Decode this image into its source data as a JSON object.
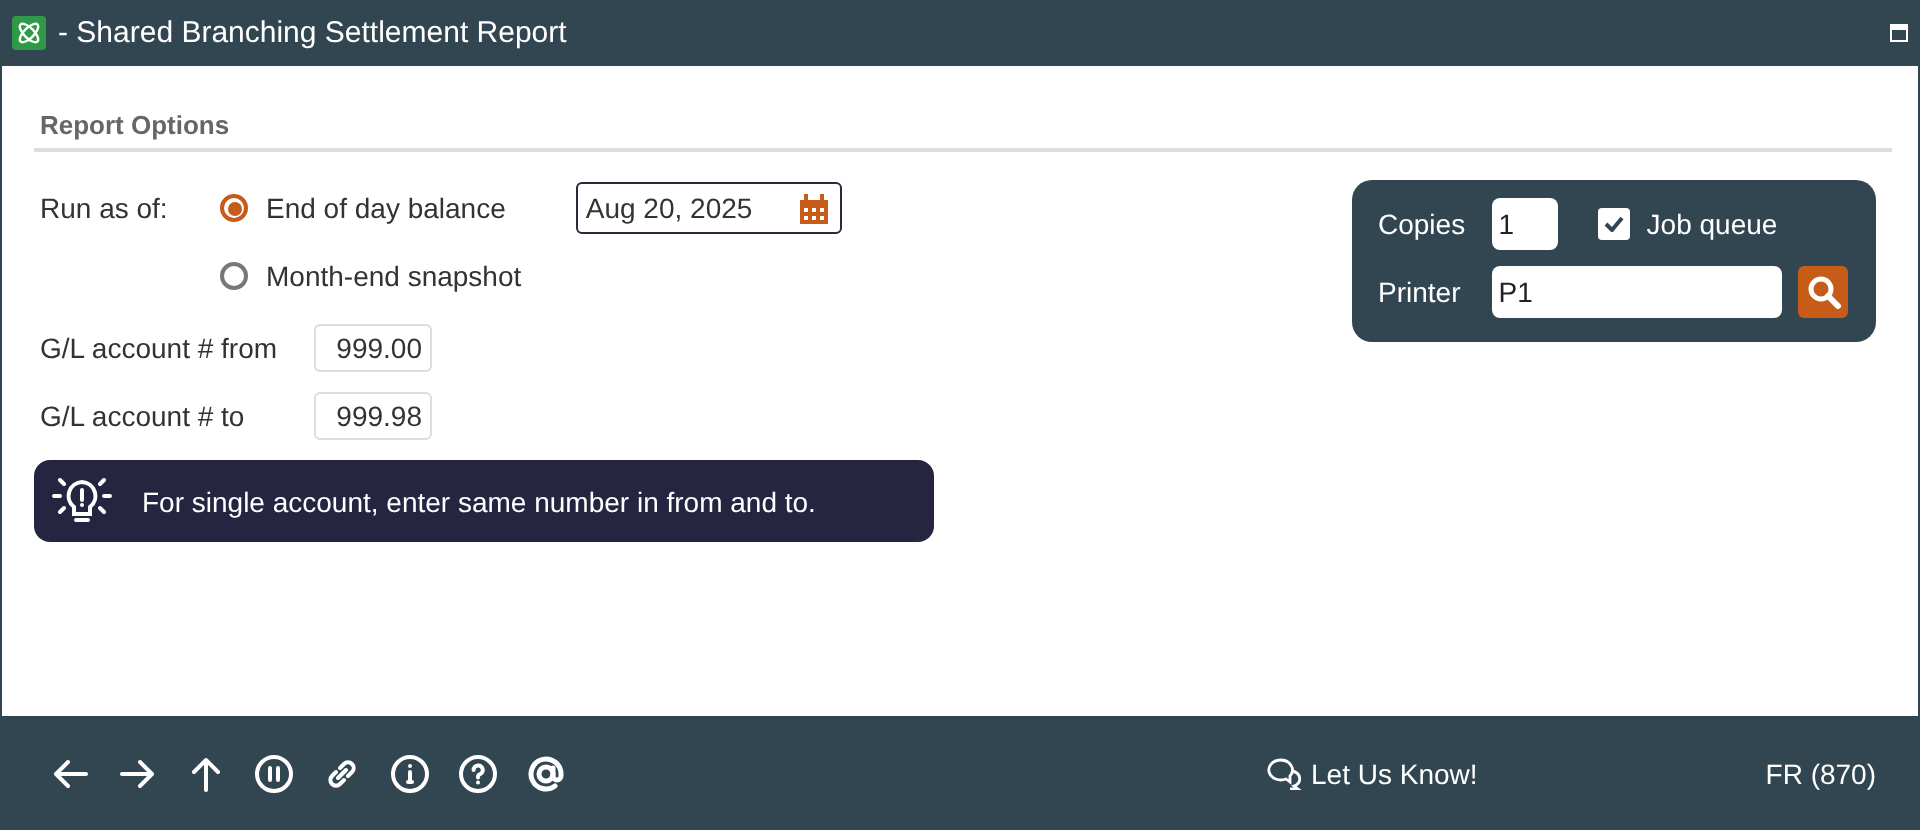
{
  "window": {
    "title": "- Shared Branching Settlement Report"
  },
  "section": {
    "title": "Report Options"
  },
  "run_as_of": {
    "label": "Run as of:",
    "options": [
      {
        "label": "End of day balance",
        "selected": true
      },
      {
        "label": "Month-end snapshot",
        "selected": false
      }
    ],
    "date": {
      "value": "Aug 20, 2025"
    }
  },
  "accounts": [
    {
      "label": "G/L account # from",
      "value": "999.00"
    },
    {
      "label": "G/L account # to",
      "value": "999.98"
    }
  ],
  "tip": "For single account, enter same number in from and to.",
  "print_panel": {
    "copies_label": "Copies",
    "copies": "1",
    "job_queue": {
      "label": "Job queue",
      "checked": true
    },
    "printer_label": "Printer",
    "printer": "P1"
  },
  "footer": {
    "feedback": "Let Us Know!",
    "user": "FR (870)"
  }
}
